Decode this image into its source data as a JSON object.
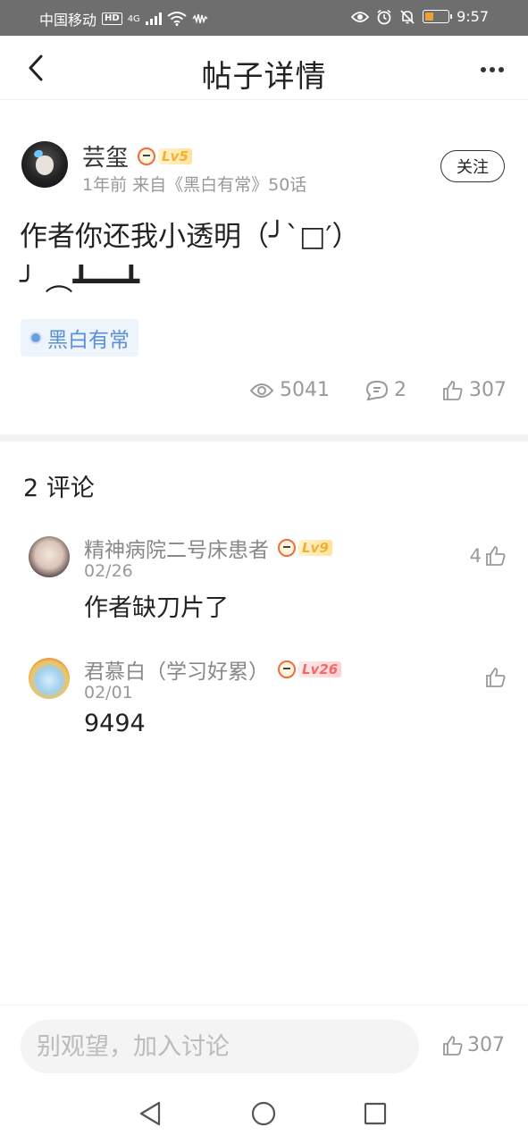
{
  "status_bar": {
    "carrier": "中国移动",
    "hd": "HD",
    "network": "4G",
    "time": "9:57"
  },
  "header": {
    "title": "帖子详情",
    "back_icon": "chevron-left-icon",
    "more_icon": "more-horizontal-icon"
  },
  "post": {
    "author": "芸玺",
    "level": "Lv5",
    "meta": "1年前 来自《黑白有常》50话",
    "follow_label": "关注",
    "content_line1": "作者你还我小透明（╯`□′）",
    "content_line2": "╯ ︵┻━━┻",
    "tag": "黑白有常",
    "views": "5041",
    "comments": "2",
    "likes": "307"
  },
  "comments_section": {
    "heading": "2 评论",
    "items": [
      {
        "name": "精神病院二号床患者",
        "level": "Lv9",
        "date": "02/26",
        "text": "作者缺刀片了",
        "likes": "4"
      },
      {
        "name": "君慕白（学习好累）",
        "level": "Lv26",
        "date": "02/01",
        "text": "9494",
        "likes": ""
      }
    ]
  },
  "bottom_bar": {
    "input_placeholder": "别观望，加入讨论",
    "likes": "307"
  },
  "colors": {
    "tag_text": "#5b8fd6",
    "tag_bg": "#eef4fc",
    "level_gold": "#f2b134",
    "level_red": "#f06a6a"
  }
}
